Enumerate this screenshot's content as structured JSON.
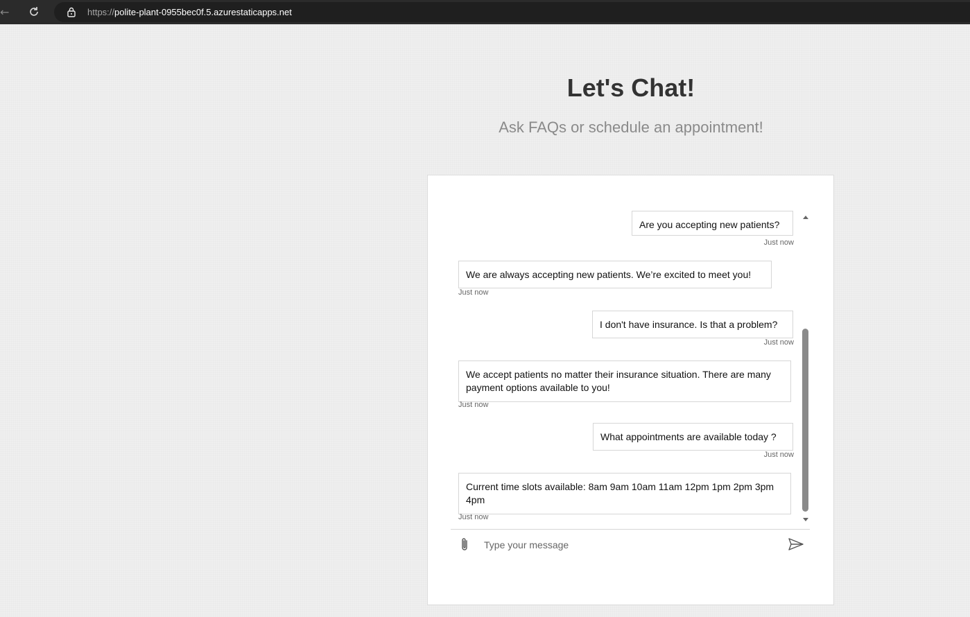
{
  "browser": {
    "url_scheme": "https://",
    "url_host": "polite-plant-0955bec0f.5.azurestaticapps.net"
  },
  "page": {
    "title": "Let's Chat!",
    "subtitle": "Ask FAQs or schedule an appointment!"
  },
  "chat": {
    "messages": [
      {
        "from": "user",
        "text": "Are you accepting new patients?",
        "time": "Just now"
      },
      {
        "from": "bot",
        "text": "We are always accepting new patients. We’re excited to meet you!",
        "time": "Just now"
      },
      {
        "from": "user",
        "text": "I don't have insurance. Is that a problem?",
        "time": "Just now"
      },
      {
        "from": "bot",
        "text": "We accept patients no matter their insurance situation. There are many payment options available to you!",
        "time": "Just now"
      },
      {
        "from": "user",
        "text": "What appointments are available today ?",
        "time": "Just now"
      },
      {
        "from": "bot",
        "text": "Current time slots available: 8am 9am 10am 11am 12pm 1pm 2pm 3pm 4pm",
        "time": "Just now"
      }
    ],
    "composer": {
      "placeholder": "Type your message"
    }
  },
  "icons": {
    "back": "arrow-left-icon",
    "reload": "reload-icon",
    "lock": "lock-icon",
    "attach": "paperclip-icon",
    "send": "send-icon"
  }
}
